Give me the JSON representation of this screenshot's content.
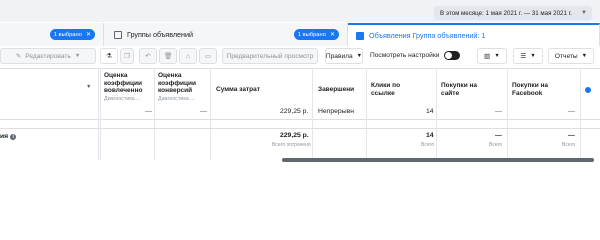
{
  "date_range": {
    "label": "В этом месяце: 1 мая 2021 г. — 31 мая 2021 г."
  },
  "tabs": [
    {
      "label": "",
      "badge": "1 выбрано"
    },
    {
      "label": "Группы объявлений",
      "badge": "1 выбрано"
    },
    {
      "label": "Объявления Группа объявлений: 1"
    }
  ],
  "toolbar": {
    "edit_label": "Редактировать",
    "preview_label": "Предварительный просмотр",
    "rules_label": "Правила",
    "view_settings_label": "Посмотреть настройки",
    "reports_label": "Отчеты"
  },
  "table": {
    "columns": [
      {
        "title": "Оценка коэффиции вовлеченно",
        "sub": "Диагностика ..."
      },
      {
        "title": "Оценка коэффиции конверсий",
        "sub": "Диагностика ..."
      },
      {
        "title": "Сумма затрат"
      },
      {
        "title": "Завершени"
      },
      {
        "title": "Клики по ссылке"
      },
      {
        "title": "Покупки на сайте"
      },
      {
        "title": "Покупки на Facebook"
      }
    ],
    "row": {
      "c1": "—",
      "c2": "—",
      "spend": "229,25 р.",
      "status": "Непрерывн",
      "clicks": "14",
      "purchases_site": "—",
      "purchases_fb": "—"
    },
    "summary": {
      "label": "ия",
      "spend": "229,25 р.",
      "spend_sub": "Всего потрачено",
      "clicks": "14",
      "clicks_sub": "Всего",
      "purchases_site": "—",
      "purchases_site_sub": "Всего",
      "purchases_fb": "—",
      "purchases_fb_sub": "Всего"
    }
  },
  "colors": {
    "accent": "#1877f2",
    "scrollbar": "#606770"
  }
}
